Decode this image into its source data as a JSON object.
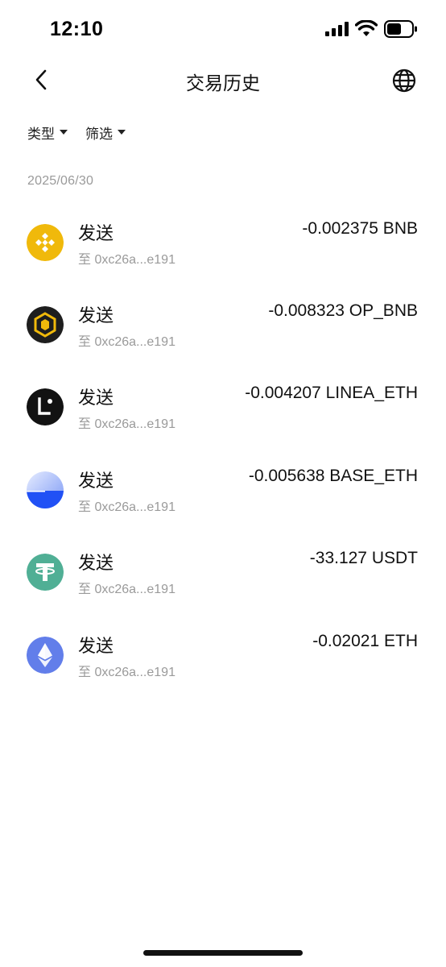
{
  "status_bar": {
    "time": "12:10"
  },
  "header": {
    "title": "交易历史"
  },
  "filters": [
    {
      "label": "类型"
    },
    {
      "label": "筛选"
    }
  ],
  "date": "2025/06/30",
  "transactions": [
    {
      "type": "发送",
      "to": "至 0xc26a...e191",
      "amount": "-0.002375 BNB",
      "icon": "bnb-icon",
      "icon_color": "#F0B90B"
    },
    {
      "type": "发送",
      "to": "至 0xc26a...e191",
      "amount": "-0.008323 OP_BNB",
      "icon": "opbnb-icon",
      "icon_color": "#1E1E1E"
    },
    {
      "type": "发送",
      "to": "至 0xc26a...e191",
      "amount": "-0.004207 LINEA_ETH",
      "icon": "linea-icon",
      "icon_color": "#121212"
    },
    {
      "type": "发送",
      "to": "至 0xc26a...e191",
      "amount": "-0.005638 BASE_ETH",
      "icon": "base-icon",
      "icon_color": "#2151F5"
    },
    {
      "type": "发送",
      "to": "至 0xc26a...e191",
      "amount": "-33.127 USDT",
      "icon": "usdt-icon",
      "icon_color": "#50AF95"
    },
    {
      "type": "发送",
      "to": "至 0xc26a...e191",
      "amount": "-0.02021 ETH",
      "icon": "eth-icon",
      "icon_color": "#627EEA"
    }
  ]
}
